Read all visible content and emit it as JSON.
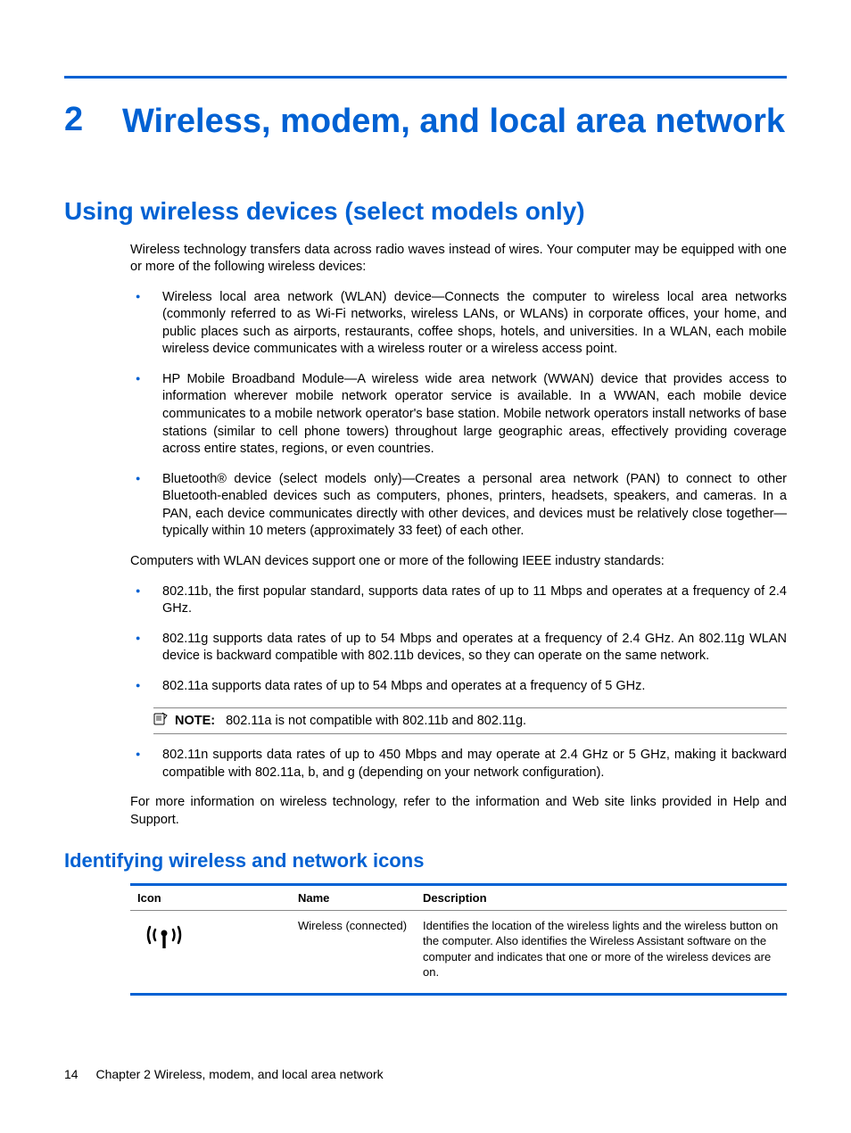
{
  "chapter": {
    "number": "2",
    "title": "Wireless, modem, and local area network"
  },
  "section": {
    "title": "Using wireless devices (select models only)",
    "intro": "Wireless technology transfers data across radio waves instead of wires. Your computer may be equipped with one or more of the following wireless devices:",
    "devices": [
      "Wireless local area network (WLAN) device—Connects the computer to wireless local area networks (commonly referred to as Wi-Fi networks, wireless LANs, or WLANs) in corporate offices, your home, and public places such as airports, restaurants, coffee shops, hotels, and universities. In a WLAN, each mobile wireless device communicates with a wireless router or a wireless access point.",
      "HP Mobile Broadband Module—A wireless wide area network (WWAN) device that provides access to information wherever mobile network operator service is available. In a WWAN, each mobile device communicates to a mobile network operator's base station. Mobile network operators install networks of base stations (similar to cell phone towers) throughout large geographic areas, effectively providing coverage across entire states, regions, or even countries.",
      "Bluetooth® device (select models only)—Creates a personal area network (PAN) to connect to other Bluetooth-enabled devices such as computers, phones, printers, headsets, speakers, and cameras. In a PAN, each device communicates directly with other devices, and devices must be relatively close together—typically within 10 meters (approximately 33 feet) of each other."
    ],
    "standards_intro": "Computers with WLAN devices support one or more of the following IEEE industry standards:",
    "standards1": [
      "802.11b, the first popular standard, supports data rates of up to 11 Mbps and operates at a frequency of 2.4 GHz.",
      "802.11g supports data rates of up to 54 Mbps and operates at a frequency of 2.4 GHz. An 802.11g WLAN device is backward compatible with 802.11b devices, so they can operate on the same network.",
      "802.11a supports data rates of up to 54 Mbps and operates at a frequency of 5 GHz."
    ],
    "note": {
      "label": "NOTE:",
      "text": "802.11a is not compatible with 802.11b and 802.11g."
    },
    "standards2": [
      "802.11n supports data rates of up to 450 Mbps and may operate at 2.4 GHz or 5 GHz, making it backward compatible with 802.11a, b, and g (depending on your network configuration)."
    ],
    "closing": "For more information on wireless technology, refer to the information and Web site links provided in Help and Support."
  },
  "subsection": {
    "title": "Identifying wireless and network icons",
    "table": {
      "headers": {
        "icon": "Icon",
        "name": "Name",
        "description": "Description"
      },
      "rows": [
        {
          "name": "Wireless (connected)",
          "description": "Identifies the location of the wireless lights and the wireless button on the computer. Also identifies the Wireless Assistant software on the computer and indicates that one or more of the wireless devices are on."
        }
      ]
    }
  },
  "footer": {
    "page": "14",
    "text": "Chapter 2   Wireless, modem, and local area network"
  }
}
